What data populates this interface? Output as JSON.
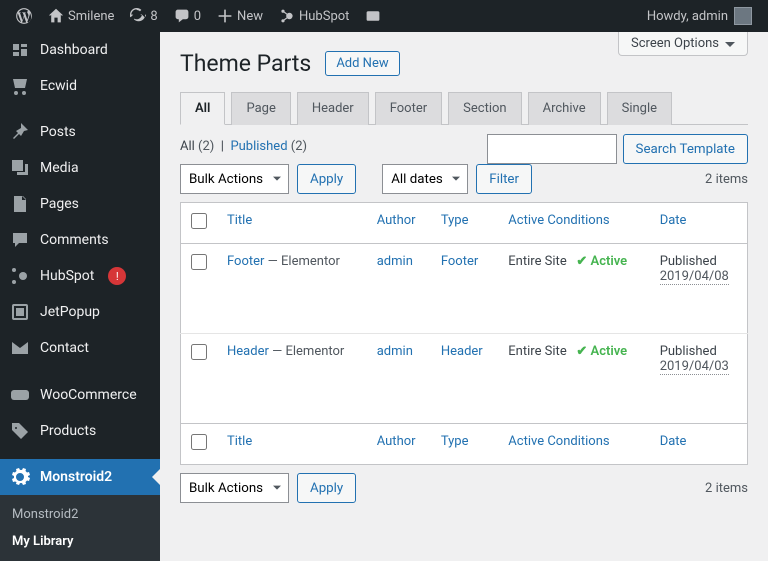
{
  "adminbar": {
    "site_name": "Smilene",
    "updates_count": "8",
    "comments_count": "0",
    "new_label": "New",
    "hubspot_label": "HubSpot",
    "howdy": "Howdy, admin"
  },
  "sidebar": {
    "items": [
      {
        "label": "Dashboard"
      },
      {
        "label": "Ecwid"
      },
      {
        "label": "Posts"
      },
      {
        "label": "Media"
      },
      {
        "label": "Pages"
      },
      {
        "label": "Comments"
      },
      {
        "label": "HubSpot",
        "badge": "!"
      },
      {
        "label": "JetPopup"
      },
      {
        "label": "Contact"
      },
      {
        "label": "WooCommerce"
      },
      {
        "label": "Products"
      },
      {
        "label": "Monstroid2"
      }
    ],
    "submenu": {
      "parent": "Monstroid2",
      "items": [
        {
          "label": "Monstroid2"
        },
        {
          "label": "My Library"
        }
      ]
    }
  },
  "screen_options": "Screen Options",
  "page": {
    "title": "Theme Parts",
    "add_new": "Add New"
  },
  "tabs": [
    "All",
    "Page",
    "Header",
    "Footer",
    "Section",
    "Archive",
    "Single"
  ],
  "subsub": {
    "all_label": "All",
    "all_count": "(2)",
    "sep": "|",
    "published_label": "Published",
    "published_count": "(2)"
  },
  "search": {
    "button": "Search Template"
  },
  "bulk": {
    "select": "Bulk Actions",
    "apply": "Apply"
  },
  "date_filter": {
    "select": "All dates",
    "filter": "Filter"
  },
  "items_count": "2 items",
  "columns": {
    "title": "Title",
    "author": "Author",
    "type": "Type",
    "conditions": "Active Conditions",
    "date": "Date"
  },
  "rows": [
    {
      "title": "Footer",
      "suffix": " — Elementor",
      "author": "admin",
      "type": "Footer",
      "scope": "Entire Site",
      "status": "Active",
      "date_state": "Published",
      "date": "2019/04/08"
    },
    {
      "title": "Header",
      "suffix": " — Elementor",
      "author": "admin",
      "type": "Header",
      "scope": "Entire Site",
      "status": "Active",
      "date_state": "Published",
      "date": "2019/04/03"
    }
  ]
}
